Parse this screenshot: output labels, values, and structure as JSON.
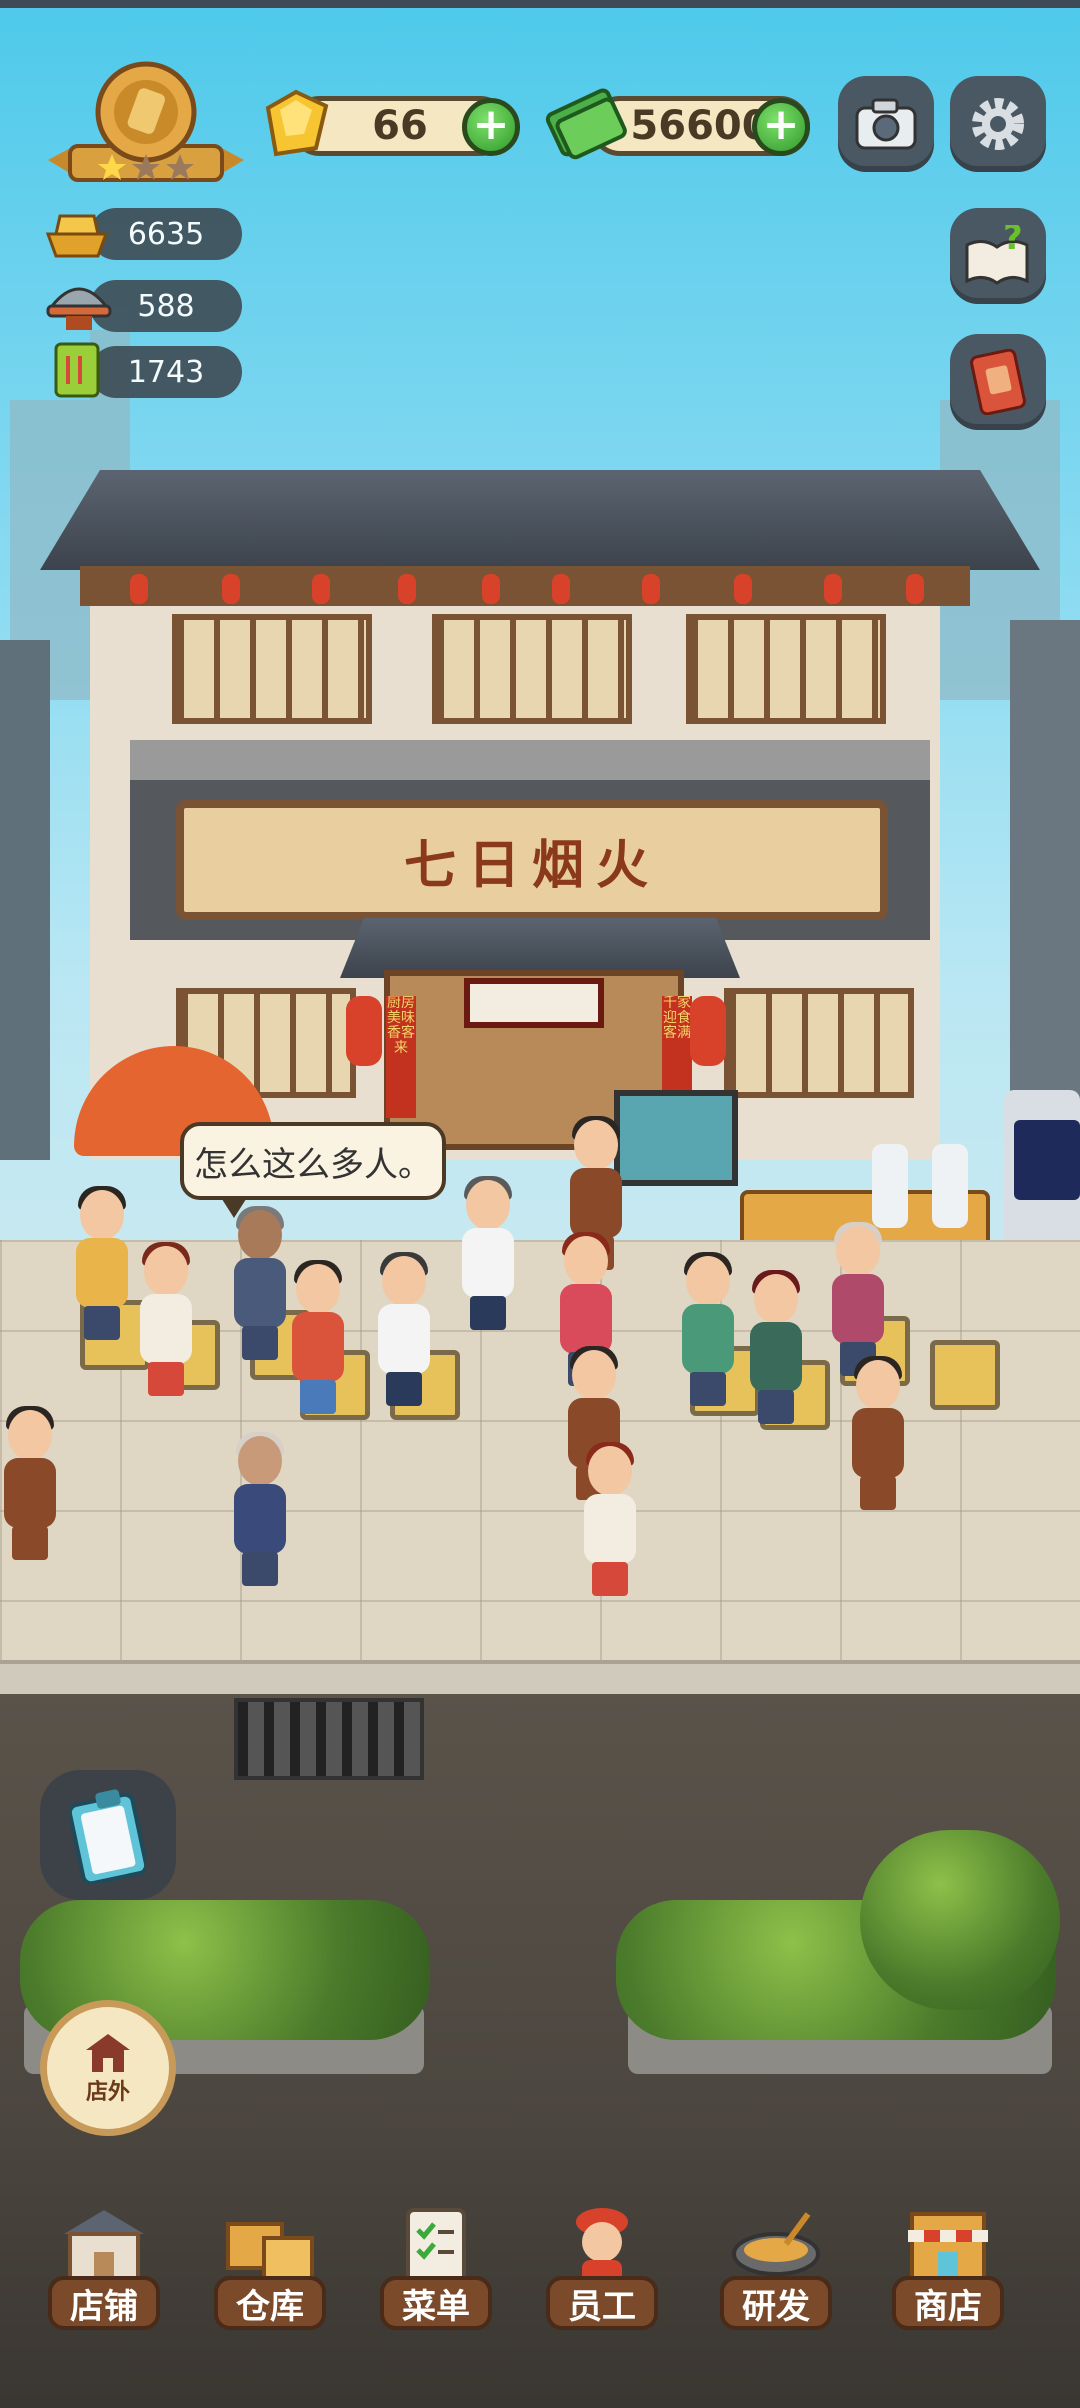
{
  "hud": {
    "gems": "66",
    "cash": "56600",
    "stats": [
      {
        "icon": "gold-ingot-icon",
        "value": "6635"
      },
      {
        "icon": "food-cloche-icon",
        "value": "588"
      },
      {
        "icon": "recipe-book-icon",
        "value": "1743"
      }
    ],
    "plus_label": "+"
  },
  "restaurant": {
    "sign": "七日烟火",
    "couplet_left": "厨房美味香客来",
    "couplet_right": "千家迎食客满"
  },
  "speech_bubble": "怎么这么多人。",
  "outside_button": {
    "label": "店外"
  },
  "nav": [
    {
      "label": "店铺",
      "icon": "shop-building-icon"
    },
    {
      "label": "仓库",
      "icon": "warehouse-boxes-icon"
    },
    {
      "label": "菜单",
      "icon": "menu-clipboard-icon"
    },
    {
      "label": "员工",
      "icon": "staff-chef-icon"
    },
    {
      "label": "研发",
      "icon": "wok-research-icon"
    },
    {
      "label": "商店",
      "icon": "store-stall-icon"
    }
  ],
  "colors": {
    "accent_green": "#2f9a2a",
    "nav_brown": "#7a4a2a",
    "pill_cream": "#f5e7c2",
    "sign_red": "#8a3a1a"
  }
}
